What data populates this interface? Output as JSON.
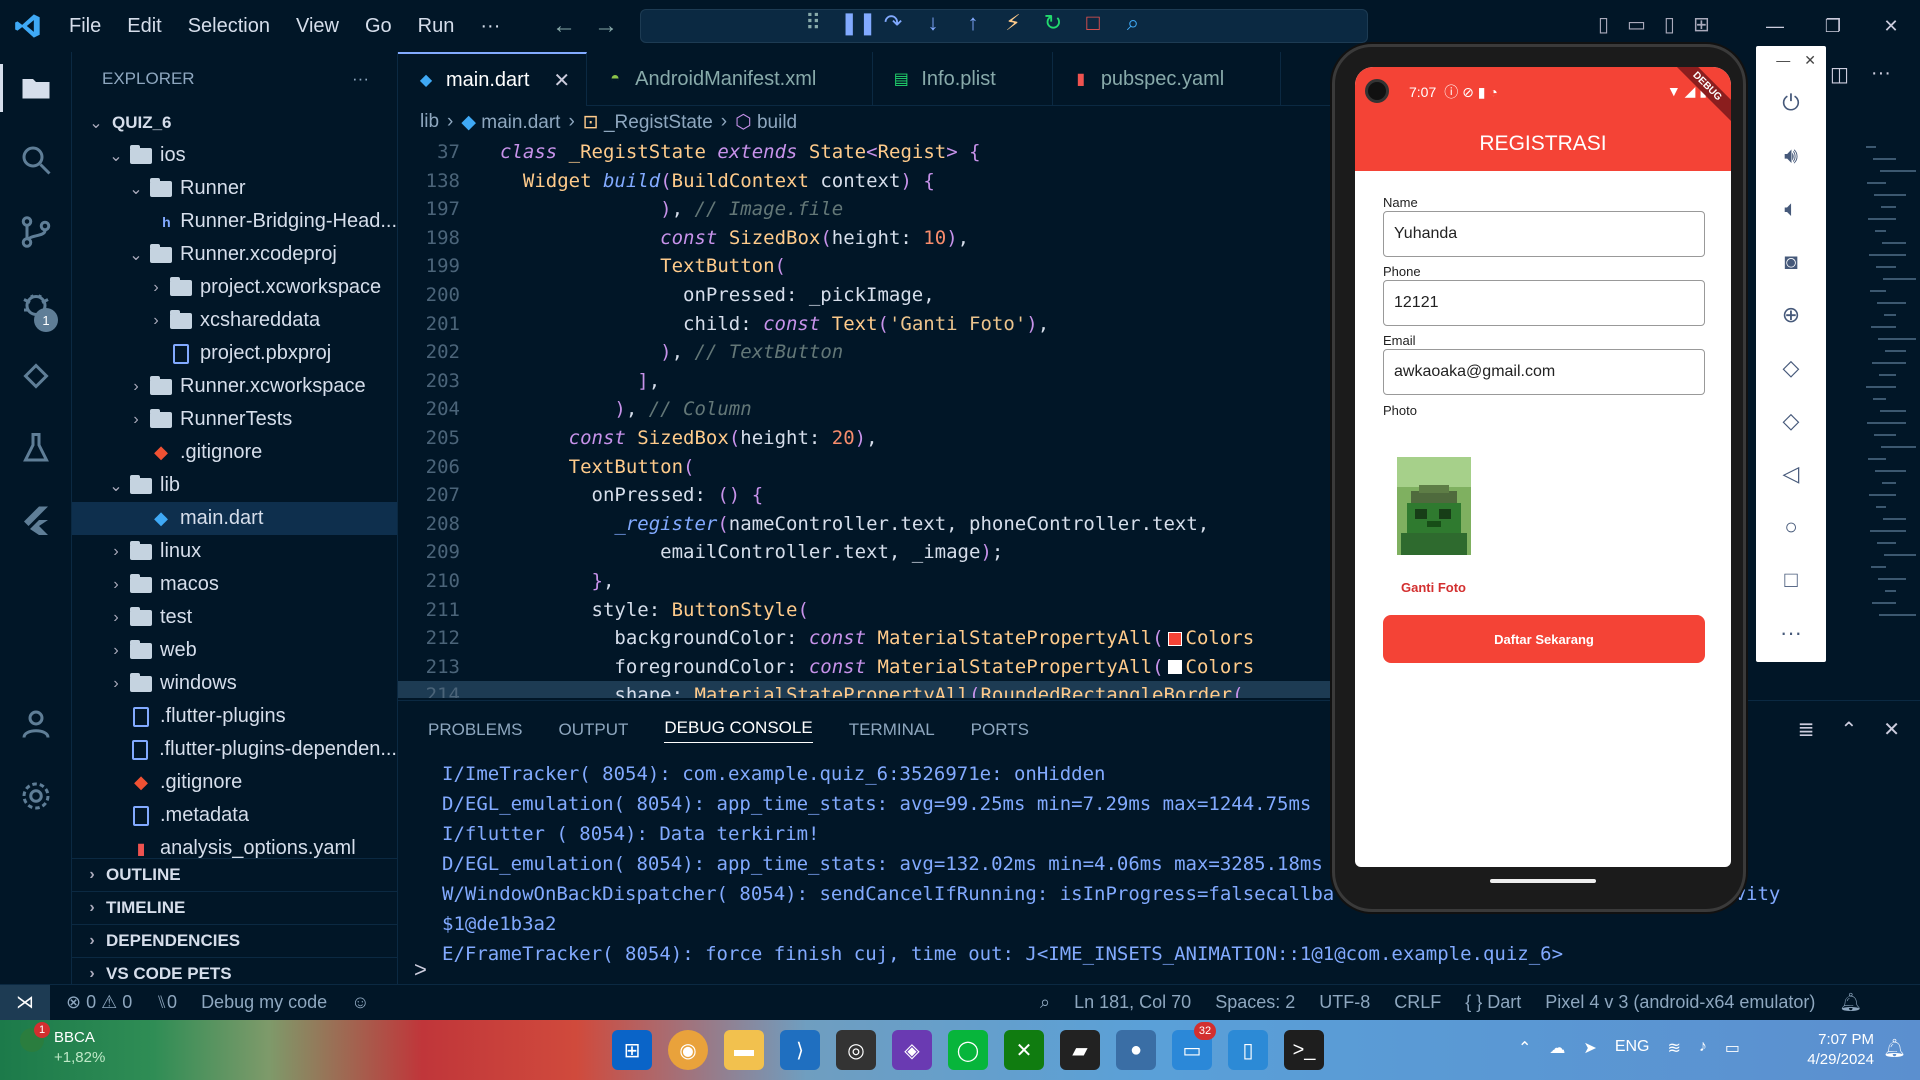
{
  "menu": [
    "File",
    "Edit",
    "Selection",
    "View",
    "Go",
    "Run",
    "···"
  ],
  "explorer": {
    "title": "EXPLORER",
    "more": "···",
    "tree": [
      {
        "label": "QUIZ_6",
        "indent": 0,
        "kind": "root",
        "open": true
      },
      {
        "label": "ios",
        "indent": 1,
        "kind": "folder",
        "open": true
      },
      {
        "label": "Runner",
        "indent": 2,
        "kind": "folder",
        "open": true
      },
      {
        "label": "Runner-Bridging-Head...",
        "indent": 3,
        "kind": "header"
      },
      {
        "label": "Runner.xcodeproj",
        "indent": 2,
        "kind": "folder",
        "open": true
      },
      {
        "label": "project.xcworkspace",
        "indent": 3,
        "kind": "folder",
        "open": false
      },
      {
        "label": "xcshareddata",
        "indent": 3,
        "kind": "folder",
        "open": false
      },
      {
        "label": "project.pbxproj",
        "indent": 3,
        "kind": "file"
      },
      {
        "label": "Runner.xcworkspace",
        "indent": 2,
        "kind": "folder",
        "open": false
      },
      {
        "label": "RunnerTests",
        "indent": 2,
        "kind": "folder",
        "open": false
      },
      {
        "label": ".gitignore",
        "indent": 2,
        "kind": "git"
      },
      {
        "label": "lib",
        "indent": 1,
        "kind": "folder",
        "open": true
      },
      {
        "label": "main.dart",
        "indent": 2,
        "kind": "dart",
        "selected": true
      },
      {
        "label": "linux",
        "indent": 1,
        "kind": "folder",
        "open": false
      },
      {
        "label": "macos",
        "indent": 1,
        "kind": "folder",
        "open": false
      },
      {
        "label": "test",
        "indent": 1,
        "kind": "folder",
        "open": false
      },
      {
        "label": "web",
        "indent": 1,
        "kind": "folder",
        "open": false
      },
      {
        "label": "windows",
        "indent": 1,
        "kind": "folder",
        "open": false
      },
      {
        "label": ".flutter-plugins",
        "indent": 1,
        "kind": "file"
      },
      {
        "label": ".flutter-plugins-dependen...",
        "indent": 1,
        "kind": "file"
      },
      {
        "label": ".gitignore",
        "indent": 1,
        "kind": "git"
      },
      {
        "label": ".metadata",
        "indent": 1,
        "kind": "file"
      },
      {
        "label": "analysis_options.yaml",
        "indent": 1,
        "kind": "yaml"
      }
    ],
    "sections": [
      "OUTLINE",
      "TIMELINE",
      "DEPENDENCIES",
      "VS CODE PETS"
    ]
  },
  "activity": {
    "debug_badge": "1"
  },
  "tabs": [
    {
      "label": "main.dart",
      "active": true,
      "icon": "dart-icon",
      "close": "✕"
    },
    {
      "label": "AndroidManifest.xml",
      "active": false,
      "icon": "android-icon"
    },
    {
      "label": "Info.plist",
      "active": false,
      "icon": "plist-icon"
    },
    {
      "label": "pubspec.yaml",
      "active": false,
      "icon": "yaml-icon"
    }
  ],
  "breadcrumb": [
    "lib",
    "main.dart",
    "_RegistState",
    "build"
  ],
  "code_lines": [
    {
      "n": "37",
      "html": "<span class='kw'>class</span> <span class='cls'>_RegistState</span> <span class='kw'>extends</span> <span class='cls'>State</span><span class='pn'>&lt;</span><span class='cls'>Regist</span><span class='pn'>&gt;</span> <span class='pn'>{</span>"
    },
    {
      "n": "138",
      "html": "  <span class='cls'>Widget</span> <span class='fn'>build</span><span class='pn'>(</span><span class='cls'>BuildContext</span> context<span class='pn'>)</span> <span class='pn'>{</span>"
    },
    {
      "n": "197",
      "html": "              <span class='pn'>)</span>, <span class='cmt'>// Image.file</span>"
    },
    {
      "n": "198",
      "html": "              <span class='kw'>const</span> <span class='cls'>SizedBox</span><span class='pn'>(</span>height: <span class='num'>10</span><span class='pn'>)</span>,"
    },
    {
      "n": "199",
      "html": "              <span class='cls'>TextButton</span><span class='pn'>(</span>"
    },
    {
      "n": "200",
      "html": "                onPressed: _pickImage,"
    },
    {
      "n": "201",
      "html": "                child: <span class='kw'>const</span> <span class='cls'>Text</span><span class='pn'>(</span><span class='str'>'Ganti Foto'</span><span class='pn'>)</span>,"
    },
    {
      "n": "202",
      "html": "              <span class='pn'>)</span>, <span class='cmt'>// TextButton</span>"
    },
    {
      "n": "203",
      "html": "            <span class='pn'>]</span>,"
    },
    {
      "n": "204",
      "html": "          <span class='pn'>)</span>, <span class='cmt'>// Column</span>"
    },
    {
      "n": "205",
      "html": "      <span class='kw'>const</span> <span class='cls'>SizedBox</span><span class='pn'>(</span>height: <span class='num'>20</span><span class='pn'>)</span>,"
    },
    {
      "n": "206",
      "html": "      <span class='cls'>TextButton</span><span class='pn'>(</span>"
    },
    {
      "n": "207",
      "html": "        onPressed: <span class='pn'>()</span> <span class='pn'>{</span>"
    },
    {
      "n": "208",
      "html": "          <span class='fn'>_register</span><span class='pn'>(</span>nameController.text, phoneController.text,"
    },
    {
      "n": "209",
      "html": "              emailController.text, _image<span class='pn'>)</span>;"
    },
    {
      "n": "210",
      "html": "        <span class='pn'>}</span>,"
    },
    {
      "n": "211",
      "html": "        style: <span class='cls'>ButtonStyle</span><span class='pn'>(</span>"
    },
    {
      "n": "212",
      "html": "          backgroundColor: <span class='kw'>const</span> <span class='cls'>MaterialStatePropertyAll</span><span class='pn'>(</span><span class='sw' style='background:#f44336'></span><span class='cls'>Colors</span>"
    },
    {
      "n": "213",
      "html": "          foregroundColor: <span class='kw'>const</span> <span class='cls'>MaterialStatePropertyAll</span><span class='pn'>(</span><span class='sw' style='background:#ffffff'></span><span class='cls'>Colors</span>"
    },
    {
      "n": "214",
      "html": "          shape: <span class='cls'>MaterialStatePropertyAll</span><span class='pn'>(</span><span class='cls'>RoundedRectangleBorder</span><span class='pn'>(</span>",
      "hl": true
    }
  ],
  "panel": {
    "tabs": [
      "PROBLEMS",
      "OUTPUT",
      "DEBUG CONSOLE",
      "TERMINAL",
      "PORTS"
    ],
    "active_tab": "DEBUG CONSOLE",
    "log": [
      "I/ImeTracker( 8054): com.example.quiz_6:3526971e: onHidden",
      "D/EGL_emulation( 8054): app_time_stats: avg=99.25ms min=7.29ms max=1244.75ms",
      "I/flutter ( 8054): Data terkirim!",
      "D/EGL_emulation( 8054): app_time_stats: avg=132.02ms min=4.06ms max=3285.18ms",
      "W/WindowOnBackDispatcher( 8054): sendCancelIfRunning: isInProgress=falsecallba                          utterActivity",
      "$1@de1b3a2",
      "E/FrameTracker( 8054): force finish cuj, time out: J<IME_INSETS_ANIMATION::1@1@com.example.quiz_6>"
    ],
    "prompt": ">"
  },
  "statusbar": {
    "errors": "⊗ 0 ⚠ 0",
    "ports": "⑊0",
    "debug": "Debug my code",
    "position": "Ln 181, Col 70",
    "spaces": "Spaces: 2",
    "encoding": "UTF-8",
    "eol": "CRLF",
    "language": "{ } Dart",
    "device": "Pixel 4 v 3 (android-x64 emulator)"
  },
  "taskbar": {
    "stock_name": "BBCA",
    "stock_change": "+1,82%",
    "stock_badge": "1",
    "lang": "ENG",
    "time": "7:07 PM",
    "date": "4/29/2024",
    "app_badge": "32"
  },
  "phone": {
    "time": "7:07",
    "debug_banner": "DEBUG",
    "title": "REGISTRASI",
    "name_label": "Name",
    "name_value": "Yuhanda",
    "phone_label": "Phone",
    "phone_value": "12121",
    "email_label": "Email",
    "email_value": "awkaoaka@gmail.com",
    "photo_label": "Photo",
    "change_photo": "Ganti Foto",
    "submit": "Daftar Sekarang"
  },
  "colors": {
    "accent": "#f44336",
    "bg": "#011627",
    "link": "#82aaff"
  }
}
